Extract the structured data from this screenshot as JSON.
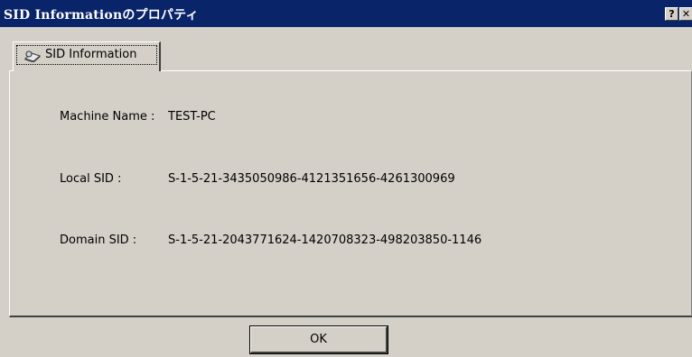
{
  "window": {
    "title": "SID Informationのプロパティ",
    "help_button": "?",
    "close_button": "✕"
  },
  "tabs": [
    {
      "label": "SID Information",
      "icon": "magnifier-book-icon",
      "selected": true
    }
  ],
  "fields": {
    "machine_name": {
      "label": "Machine Name :",
      "value": "TEST-PC"
    },
    "local_sid": {
      "label": "Local SID :",
      "value": "S-1-5-21-3435050986-4121351656-4261300969"
    },
    "domain_sid": {
      "label": "Domain SID :",
      "value": "S-1-5-21-2043771624-1420708323-498203850-1146"
    }
  },
  "buttons": {
    "ok": "OK"
  },
  "colors": {
    "titlebar": "#0a246a",
    "face": "#d4d0c8"
  }
}
